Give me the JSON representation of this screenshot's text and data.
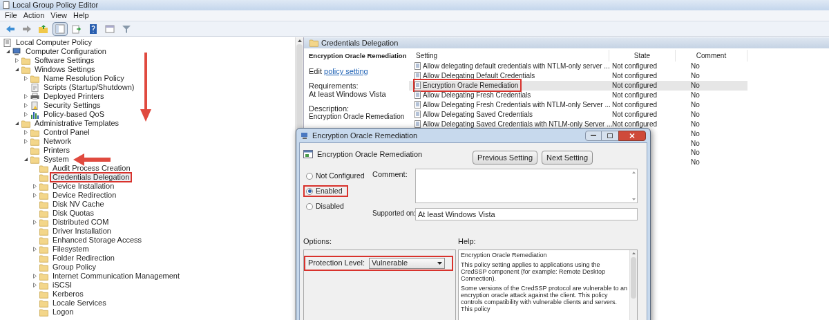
{
  "window": {
    "title": "Local Group Policy Editor"
  },
  "menu": [
    "File",
    "Action",
    "View",
    "Help"
  ],
  "toolbar": [
    {
      "kind": "back",
      "pressed": false
    },
    {
      "kind": "forward",
      "pressed": false
    },
    {
      "kind": "up",
      "pressed": false
    },
    {
      "kind": "tree",
      "pressed": true
    },
    {
      "kind": "export",
      "pressed": false
    },
    {
      "kind": "help",
      "pressed": false
    },
    {
      "kind": "pane",
      "pressed": false
    },
    {
      "kind": "filter",
      "pressed": false
    }
  ],
  "tree": [
    {
      "label": "Local Computer Policy",
      "kind": "policy",
      "outlined": false,
      "children": [
        {
          "label": "Computer Configuration",
          "kind": "computer",
          "expanded": true,
          "outlined": false,
          "children": [
            {
              "label": "Software Settings",
              "kind": "folder",
              "expanded": false,
              "outlined": false
            },
            {
              "label": "Windows Settings",
              "kind": "folder",
              "expanded": true,
              "outlined": false,
              "children": [
                {
                  "label": "Name Resolution Policy",
                  "kind": "folder",
                  "expanded": false,
                  "outlined": false
                },
                {
                  "label": "Scripts (Startup/Shutdown)",
                  "kind": "script",
                  "outlined": false
                },
                {
                  "label": "Deployed Printers",
                  "kind": "printer",
                  "expanded": false,
                  "outlined": false
                },
                {
                  "label": "Security Settings",
                  "kind": "security",
                  "expanded": false,
                  "outlined": false
                },
                {
                  "label": "Policy-based QoS",
                  "kind": "chart",
                  "expanded": false,
                  "outlined": false
                }
              ]
            },
            {
              "label": "Administrative Templates",
              "kind": "folder",
              "expanded": true,
              "outlined": false,
              "children": [
                {
                  "label": "Control Panel",
                  "kind": "folder",
                  "expanded": false,
                  "outlined": false
                },
                {
                  "label": "Network",
                  "kind": "folder",
                  "expanded": false,
                  "outlined": false
                },
                {
                  "label": "Printers",
                  "kind": "folder",
                  "outlined": false
                },
                {
                  "label": "System",
                  "kind": "folder",
                  "expanded": true,
                  "outlined": false,
                  "children": [
                    {
                      "label": "Audit Process Creation",
                      "kind": "folder",
                      "outlined": false
                    },
                    {
                      "label": "Credentials Delegation",
                      "kind": "folder",
                      "outlined": true
                    },
                    {
                      "label": "Device Installation",
                      "kind": "folder",
                      "expanded": false,
                      "outlined": false
                    },
                    {
                      "label": "Device Redirection",
                      "kind": "folder",
                      "expanded": false,
                      "outlined": false
                    },
                    {
                      "label": "Disk NV Cache",
                      "kind": "folder",
                      "outlined": false
                    },
                    {
                      "label": "Disk Quotas",
                      "kind": "folder",
                      "outlined": false
                    },
                    {
                      "label": "Distributed COM",
                      "kind": "folder",
                      "expanded": false,
                      "outlined": false
                    },
                    {
                      "label": "Driver Installation",
                      "kind": "folder",
                      "outlined": false
                    },
                    {
                      "label": "Enhanced Storage Access",
                      "kind": "folder",
                      "outlined": false
                    },
                    {
                      "label": "Filesystem",
                      "kind": "folder",
                      "expanded": false,
                      "outlined": false
                    },
                    {
                      "label": "Folder Redirection",
                      "kind": "folder",
                      "outlined": false
                    },
                    {
                      "label": "Group Policy",
                      "kind": "folder",
                      "outlined": false
                    },
                    {
                      "label": "Internet Communication Management",
                      "kind": "folder",
                      "expanded": false,
                      "outlined": false
                    },
                    {
                      "label": "iSCSI",
                      "kind": "folder",
                      "expanded": false,
                      "outlined": false
                    },
                    {
                      "label": "Kerberos",
                      "kind": "folder",
                      "outlined": false
                    },
                    {
                      "label": "Locale Services",
                      "kind": "folder",
                      "outlined": false
                    },
                    {
                      "label": "Logon",
                      "kind": "folder",
                      "outlined": false
                    }
                  ]
                }
              ]
            }
          ]
        }
      ]
    }
  ],
  "arrows": [
    {
      "kind": "down"
    },
    {
      "kind": "left"
    }
  ],
  "panel": {
    "header": "Credentials Delegation",
    "title": "Encryption Oracle Remediation",
    "edit_prefix": "Edit",
    "edit_link": "policy setting",
    "requirements_label": "Requirements:",
    "requirements": "At least Windows Vista",
    "description_label": "Description:",
    "description": "Encryption Oracle Remediation"
  },
  "table": {
    "columns": [
      "Setting",
      "State",
      "Comment"
    ],
    "rows": [
      {
        "setting": "Allow delegating default credentials with NTLM-only server ...",
        "state": "Not configured",
        "comment": "No",
        "selected": false,
        "outlined": false
      },
      {
        "setting": "Allow Delegating Default Credentials",
        "state": "Not configured",
        "comment": "No",
        "selected": false,
        "outlined": false
      },
      {
        "setting": "Encryption Oracle Remediation",
        "state": "Not configured",
        "comment": "No",
        "selected": true,
        "outlined": true
      },
      {
        "setting": "Allow Delegating Fresh Credentials",
        "state": "Not configured",
        "comment": "No",
        "selected": false,
        "outlined": false
      },
      {
        "setting": "Allow Delegating Fresh Credentials with NTLM-only Server ...",
        "state": "Not configured",
        "comment": "No",
        "selected": false,
        "outlined": false
      },
      {
        "setting": "Allow Delegating Saved Credentials",
        "state": "Not configured",
        "comment": "No",
        "selected": false,
        "outlined": false
      },
      {
        "setting": "Allow Delegating Saved Credentials with NTLM-only Server ...",
        "state": "Not configured",
        "comment": "No",
        "selected": false,
        "outlined": false
      },
      {
        "comment": "No"
      },
      {
        "comment": "No"
      },
      {
        "comment": "No"
      },
      {
        "comment": "No"
      }
    ]
  },
  "dialog": {
    "title": "Encryption Oracle Remediation",
    "policy_name": "Encryption Oracle Remediation",
    "buttons": [
      "Previous Setting",
      "Next Setting"
    ],
    "radios": [
      {
        "label": "Not Configured",
        "selected": false,
        "outlined": false
      },
      {
        "label": "Enabled",
        "selected": true,
        "outlined": true
      },
      {
        "label": "Disabled",
        "selected": false,
        "outlined": false
      }
    ],
    "comment_label": "Comment:",
    "supported_label": "Supported on:",
    "supported": "At least Windows Vista",
    "options_label": "Options:",
    "help_label": "Help:",
    "option": {
      "label": "Protection Level:",
      "value": "Vulnerable",
      "outlined": true
    },
    "help": [
      "Encryption Oracle Remediation",
      "This policy setting applies to applications using the CredSSP component (for example: Remote Desktop Connection).",
      "Some versions of the CredSSP protocol are vulnerable to an encryption oracle attack against the client.  This policy controls compatibility with vulnerable clients and servers.  This policy"
    ]
  }
}
